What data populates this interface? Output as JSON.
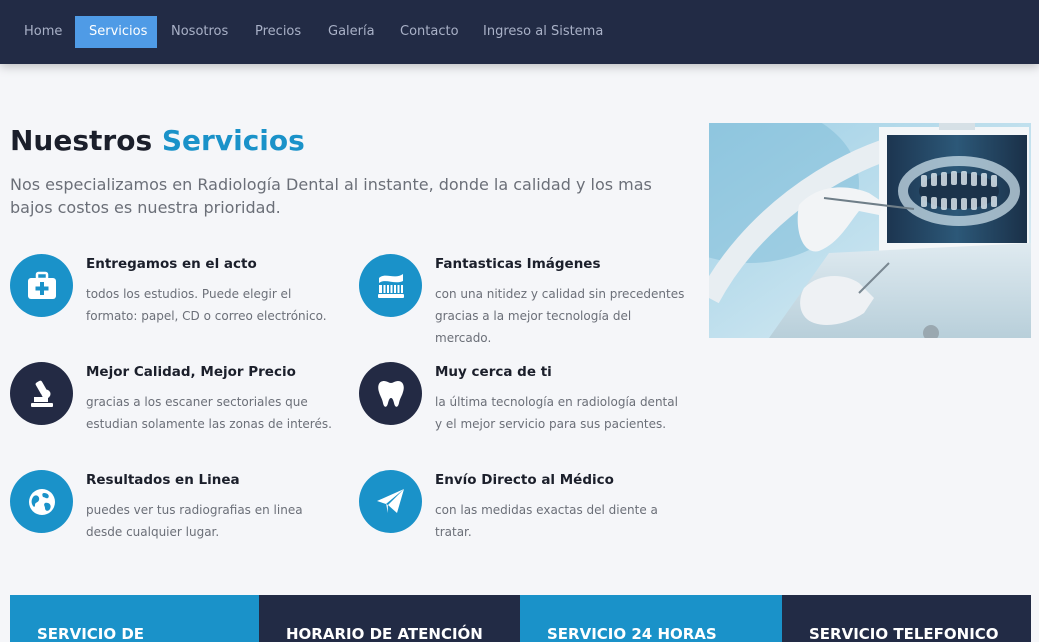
{
  "nav": {
    "items": [
      {
        "label": "Home"
      },
      {
        "label": "Servicios",
        "active": true
      },
      {
        "label": "Nosotros"
      },
      {
        "label": "Precios"
      },
      {
        "label": "Galería"
      },
      {
        "label": "Contacto"
      },
      {
        "label": "Ingreso al Sistema"
      }
    ]
  },
  "hero": {
    "title_main": "Nuestros",
    "title_accent": "Servicios",
    "lead": "Nos especializamos en Radiología Dental al instante, donde la calidad y los mas bajos costos es nuestra prioridad."
  },
  "services": [
    {
      "title": "Entregamos en el acto",
      "text": "todos los estudios. Puede elegir el formato: papel, CD o correo electrónico.",
      "icon": "first-aid-kit-icon"
    },
    {
      "title": "Fantasticas Imágenes",
      "text": "con una nitidez y calidad sin precedentes gracias a la mejor tecnología del mercado.",
      "icon": "toothbrush-icon"
    },
    {
      "title": "Mejor Calidad, Mejor Precio",
      "text": "gracias a los escaner sectoriales que estudian solamente las zonas de interés.",
      "icon": "microscope-icon"
    },
    {
      "title": "Muy cerca de ti",
      "text": "la última tecnología en radiología dental y el mejor servicio para sus pacientes.",
      "icon": "tooth-icon"
    },
    {
      "title": "Resultados en Linea",
      "text": "puedes ver tus radiografias en linea desde cualquier lugar.",
      "icon": "globe-icon"
    },
    {
      "title": "Envío Directo al Médico",
      "text": "con las medidas exactas del diente a tratar.",
      "icon": "paper-plane-icon"
    }
  ],
  "bands": [
    {
      "label": "SERVICIO DE"
    },
    {
      "label": "HORARIO DE ATENCIÓN"
    },
    {
      "label": "SERVICIO 24 HORAS"
    },
    {
      "label": "SERVICIO TELEFONICO"
    }
  ],
  "colors": {
    "nav_bg": "#222b45",
    "nav_active": "#4f9be6",
    "accent_blue": "#1a92c9",
    "dark_navy": "#232a44",
    "page_bg": "#f5f6f9"
  }
}
